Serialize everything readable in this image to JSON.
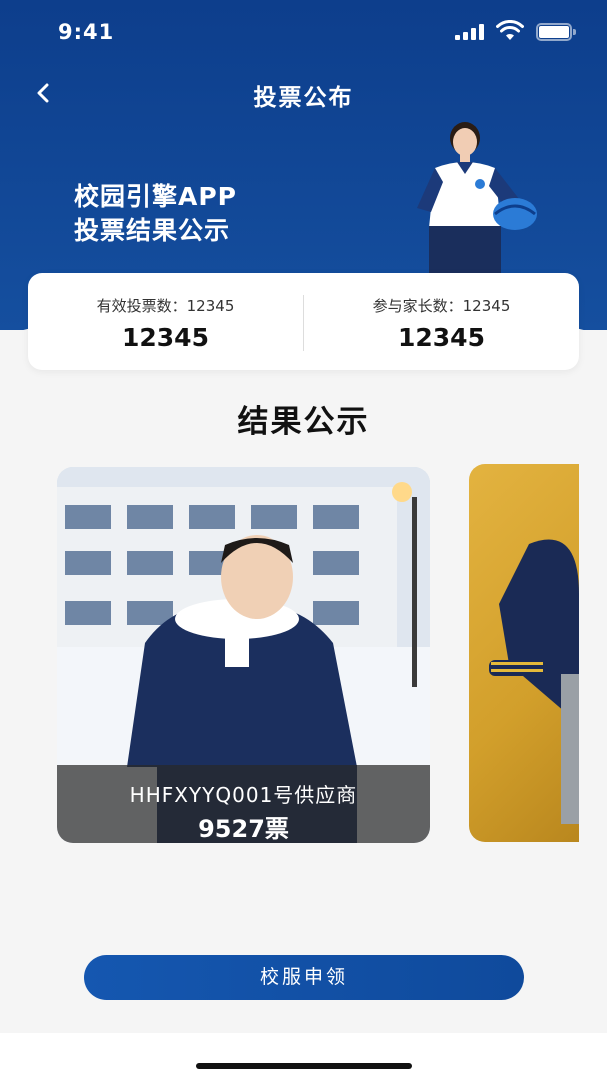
{
  "status_bar": {
    "time": "9:41"
  },
  "nav": {
    "title": "投票公布"
  },
  "hero": {
    "heading_line1": "校园引擎APP",
    "heading_line2": "投票结果公示"
  },
  "stats": {
    "valid_votes_label": "有效投票数：12345",
    "valid_votes_value": "12345",
    "parents_label": "参与家长数：12345",
    "parents_value": "12345"
  },
  "results": {
    "title": "结果公示",
    "cards": [
      {
        "supplier": "HHFXYYQ001号供应商",
        "votes": "9527票"
      }
    ]
  },
  "actions": {
    "apply_label": "校服申领"
  },
  "colors": {
    "brand_blue": "#0d3e8c",
    "button_blue": "#1557b0",
    "background": "#f5f5f5"
  }
}
